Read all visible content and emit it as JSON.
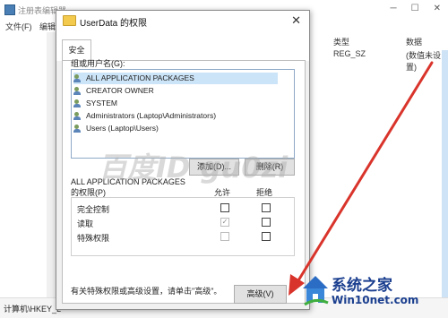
{
  "app": {
    "title": "注册表编辑器",
    "menu": [
      "文件(F)",
      "编辑"
    ]
  },
  "list": {
    "columns": [
      "类型",
      "数据"
    ],
    "row": {
      "type": "REG_SZ",
      "data": "(数值未设置)"
    }
  },
  "status_bar": {
    "path": "计算机\\HKEY_L"
  },
  "dialog": {
    "title": "UserData 的权限",
    "close_glyph": "✕",
    "tab": "安全",
    "groups_label": "组或用户名(G):",
    "users": [
      {
        "name": "ALL APPLICATION PACKAGES",
        "selected": true
      },
      {
        "name": "CREATOR OWNER",
        "selected": false
      },
      {
        "name": "SYSTEM",
        "selected": false
      },
      {
        "name": "Administrators (Laptop\\Administrators)",
        "selected": false
      },
      {
        "name": "Users (Laptop\\Users)",
        "selected": false
      }
    ],
    "add_button": "添加(D)...",
    "remove_button": "删除(R)",
    "perm_for_line1": "ALL APPLICATION PACKAGES",
    "perm_for_line2": "的权限(P)",
    "allow_col": "允许",
    "deny_col": "拒绝",
    "permissions": [
      {
        "name": "完全控制",
        "allow": false,
        "deny": false,
        "allow_disabled": false
      },
      {
        "name": "读取",
        "allow": true,
        "deny": false,
        "allow_disabled": true
      },
      {
        "name": "特殊权限",
        "allow": false,
        "deny": false,
        "allow_disabled": true
      }
    ],
    "advanced_hint": "有关特殊权限或高级设置，请单击\"高级\"。",
    "advanced_button": "高级(V)"
  },
  "overlay": {
    "watermark": "百度ID gu0zi",
    "logo_line1": "系统之家",
    "logo_line2": "Win10net.com",
    "arrow_color": "#d9342b"
  }
}
